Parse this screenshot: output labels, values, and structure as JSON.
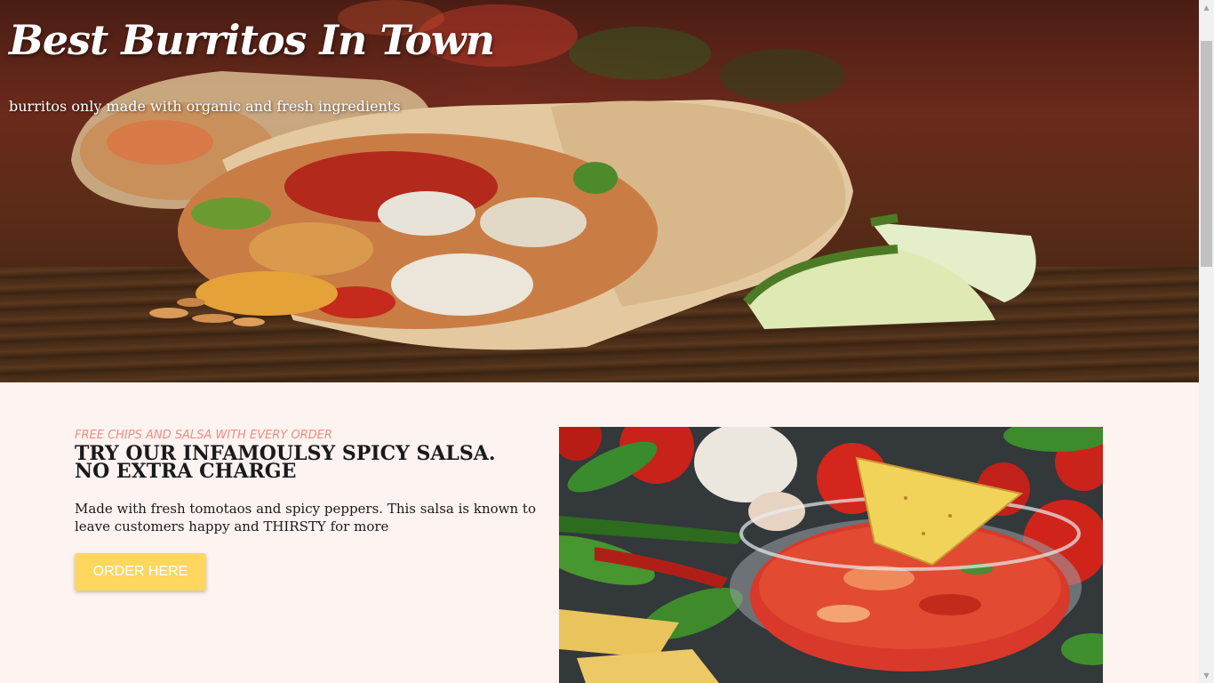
{
  "hero": {
    "title": "Best Burritos In Town",
    "subtitle": "burritos only made with organic and fresh ingredients"
  },
  "promo": {
    "eyebrow": "FREE CHIPS AND SALSA WITH EVERY ORDER",
    "heading": "TRY OUR INFAMOULSY SPICY SALSA. NO EXTRA CHARGE",
    "description": "Made with fresh tomotaos and spicy peppers. This salsa is known to leave customers happy and THIRSTY for more",
    "button_label": "ORDER HERE"
  },
  "colors": {
    "page_background": "#fdf3f1",
    "accent_eyebrow": "#f08d7e",
    "button": "#ffd75f",
    "button_text": "#ffffff"
  },
  "images": {
    "hero": "burrito-photo",
    "salsa": "salsa-and-chips-photo"
  }
}
